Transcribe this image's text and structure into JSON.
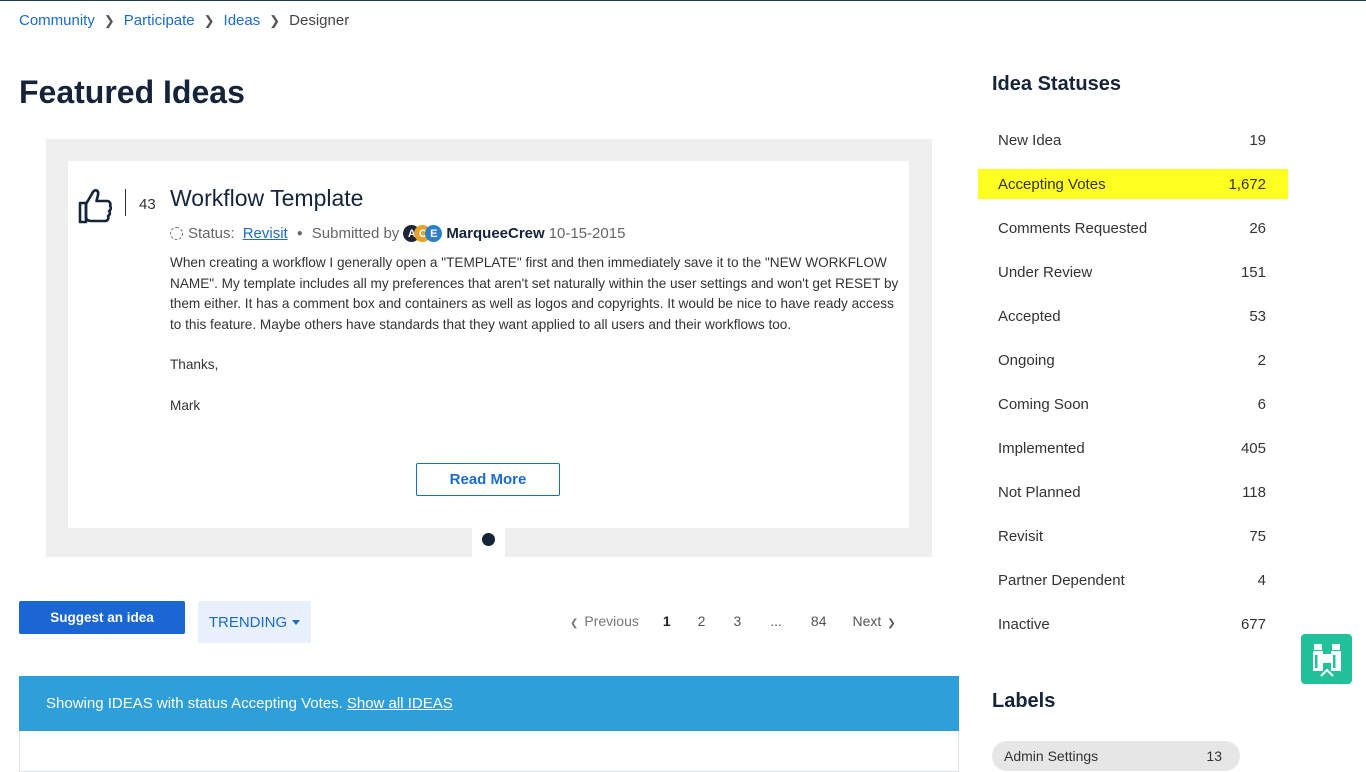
{
  "breadcrumb": {
    "items": [
      "Community",
      "Participate",
      "Ideas"
    ],
    "current": "Designer"
  },
  "page": {
    "title": "Featured Ideas"
  },
  "featured": {
    "votes": "43",
    "title": "Workflow Template",
    "status_label": "Status:",
    "status_value": "Revisit",
    "submitted_by": "Submitted by",
    "badge_letters": [
      "A",
      "C",
      "E"
    ],
    "author": "MarqueeCrew",
    "date": "10-15-2015",
    "body": [
      "When creating a workflow I generally open a \"TEMPLATE\" first and then immediately save it to the \"NEW WORKFLOW NAME\".  My template includes all my preferences that aren't set naturally within the user settings and won't get RESET by them either.  It has a comment box and containers as well as logos and copyrights.  It would be nice to have ready access to this feature.  Maybe others have standards that they want applied to all users and their workflows too.",
      "Thanks,",
      "Mark"
    ],
    "read_more": "Read More"
  },
  "toolbar": {
    "suggest": "Suggest an idea",
    "sort": "TRENDING"
  },
  "pagination": {
    "previous": "Previous",
    "pages": [
      "1",
      "2",
      "3",
      "...",
      "84"
    ],
    "next": "Next"
  },
  "filter_bar": {
    "text": "Showing IDEAS with status Accepting Votes.",
    "link": "Show all IDEAS"
  },
  "sidebar": {
    "statuses_title": "Idea Statuses",
    "statuses": [
      {
        "name": "New Idea",
        "count": "19"
      },
      {
        "name": "Accepting Votes",
        "count": "1,672"
      },
      {
        "name": "Comments Requested",
        "count": "26"
      },
      {
        "name": "Under Review",
        "count": "151"
      },
      {
        "name": "Accepted",
        "count": "53"
      },
      {
        "name": "Ongoing",
        "count": "2"
      },
      {
        "name": "Coming Soon",
        "count": "6"
      },
      {
        "name": "Implemented",
        "count": "405"
      },
      {
        "name": "Not Planned",
        "count": "118"
      },
      {
        "name": "Revisit",
        "count": "75"
      },
      {
        "name": "Partner Dependent",
        "count": "4"
      },
      {
        "name": "Inactive",
        "count": "677"
      }
    ],
    "highlight_color": "#ffff22",
    "labels_title": "Labels",
    "labels": [
      {
        "name": "Admin Settings",
        "count": "13"
      }
    ]
  },
  "icons": {
    "thumb": "thumbs-up-icon",
    "status": "status-ring-icon",
    "floating": "binoculars-icon"
  },
  "colors": {
    "link": "#1a6cc8",
    "primary_button": "#1a66d2",
    "info_bar": "#2e9fd9",
    "floating_button": "#21c29a"
  }
}
